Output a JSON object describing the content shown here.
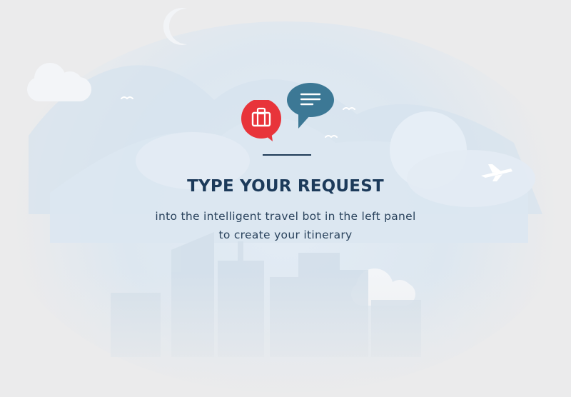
{
  "empty_state": {
    "headline": "TYPE YOUR REQUEST",
    "description_line_1": "into the intelligent travel bot in the left panel",
    "description_line_2": "to create your itinerary",
    "icons": {
      "luggage": "suitcase-icon",
      "chat": "chat-bubble-icon"
    }
  },
  "colors": {
    "background": "#ebebec",
    "headline": "#1c3a5a",
    "accent_red": "#e8343a",
    "accent_blue": "#3c7895",
    "sky": "#dbe6f0"
  }
}
